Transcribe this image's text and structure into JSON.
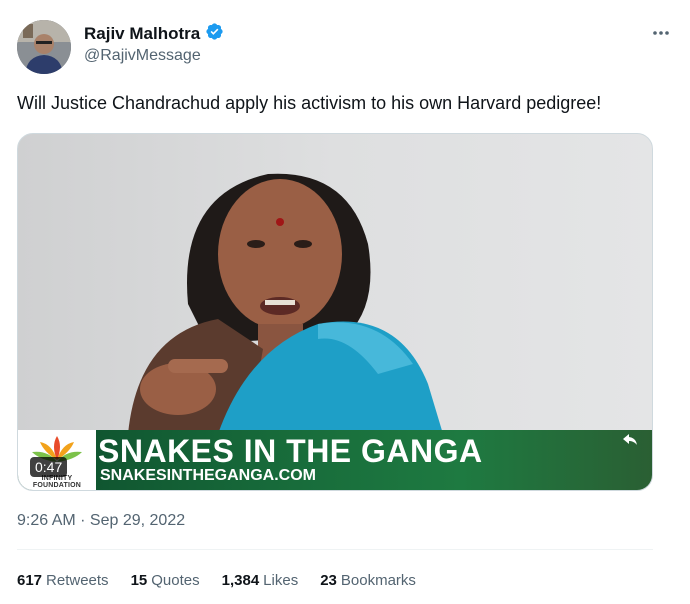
{
  "author": {
    "display_name": "Rajiv Malhotra",
    "handle": "@RajivMessage",
    "verified": true
  },
  "tweet": {
    "text": "Will Justice Chandrachud apply his activism to his own Harvard pedigree!",
    "timestamp": "9:26 AM · Sep 29, 2022"
  },
  "video": {
    "duration": "0:47",
    "banner_title": "SNAKES IN THE GANGA",
    "banner_url": "SNAKESINTHEGANGA.COM",
    "logo_text_line1": "INFINITY",
    "logo_text_line2": "FOUNDATION"
  },
  "stats": [
    {
      "count": "617",
      "label": "Retweets"
    },
    {
      "count": "15",
      "label": "Quotes"
    },
    {
      "count": "1,384",
      "label": "Likes"
    },
    {
      "count": "23",
      "label": "Bookmarks"
    }
  ],
  "colors": {
    "verified_blue": "#1d9bf0",
    "secondary_text": "#536471",
    "banner_green": "#176a3a"
  }
}
